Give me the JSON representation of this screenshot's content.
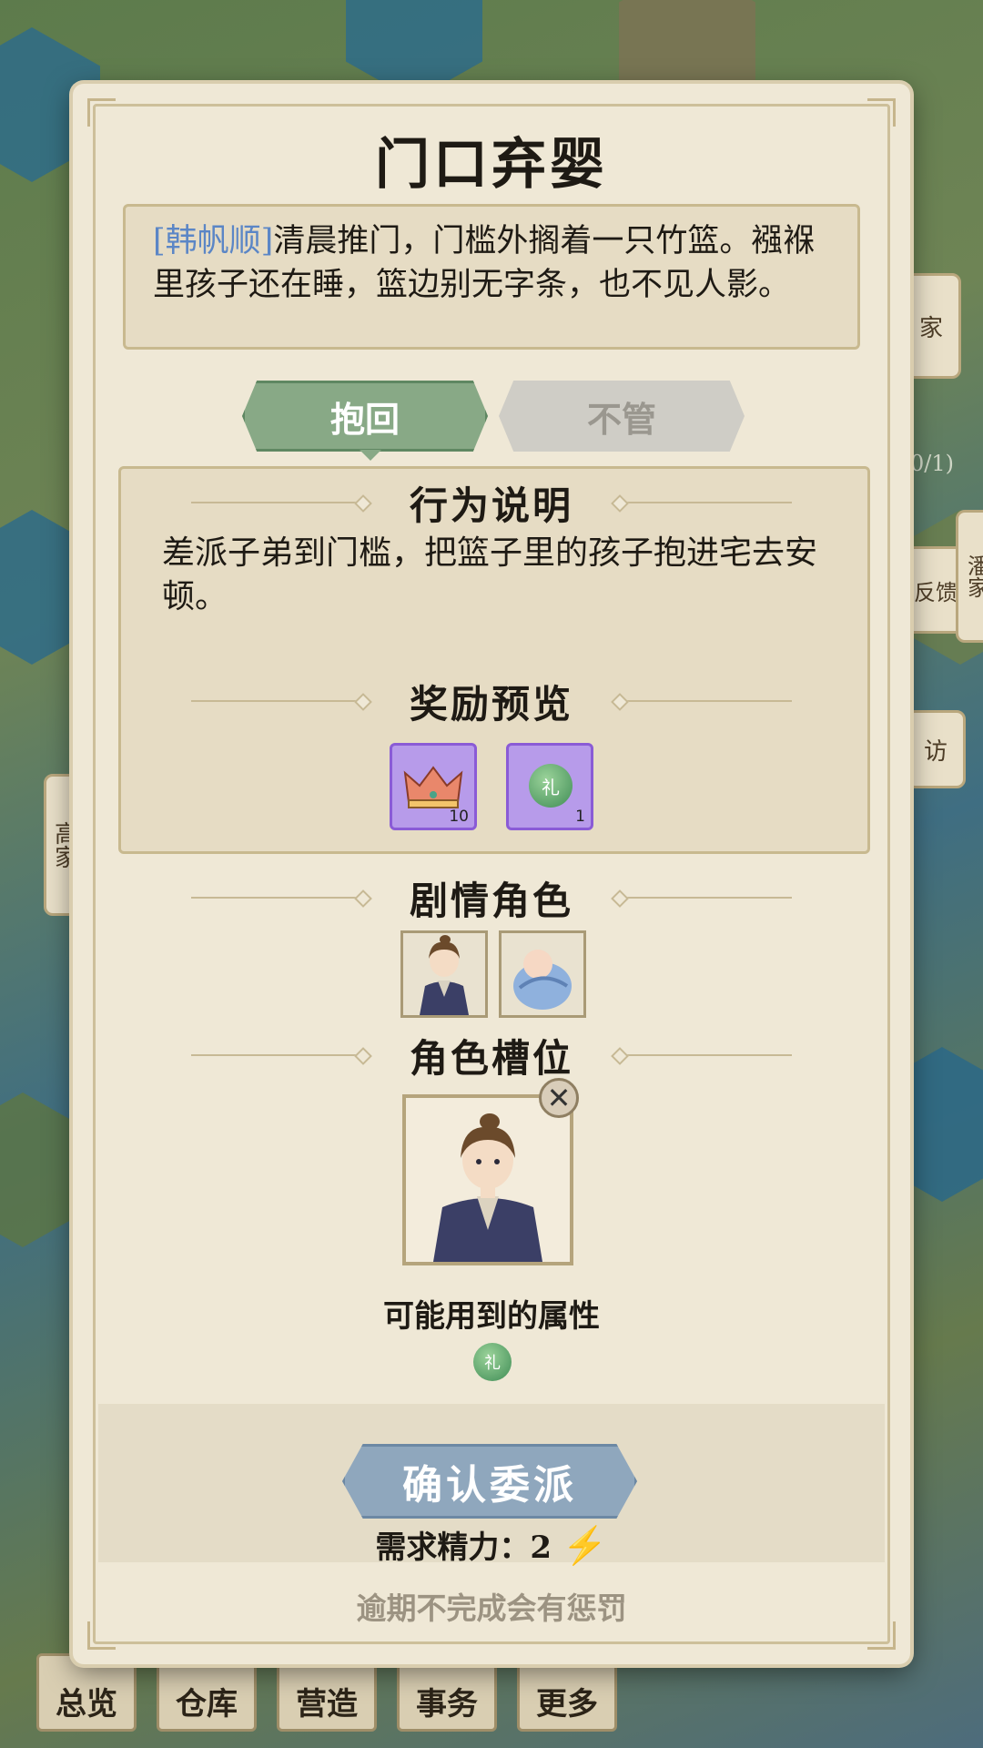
{
  "dialog": {
    "title": "门口弃婴",
    "story_name": "[韩帆顺]",
    "story_text": "清晨推门，门槛外搁着一只竹篮。襁褓里孩子还在睡，篮边别无字条，也不见人影。",
    "tabs": [
      {
        "label": "抱回",
        "active": true
      },
      {
        "label": "不管",
        "active": false
      }
    ],
    "behavior_heading": "行为说明",
    "behavior_text": "差派子弟到门槛，把篮子里的孩子抱进宅去安顿。",
    "reward_heading": "奖励预览",
    "rewards": [
      {
        "icon": "crown-icon",
        "count": "10"
      },
      {
        "icon": "etiquette-orb-icon",
        "glyph": "礼",
        "count": "1"
      }
    ],
    "characters_heading": "剧情角色",
    "characters": [
      "young-man-portrait",
      "baby-portrait"
    ],
    "slot_heading": "角色槽位",
    "attr_label": "可能用到的属性",
    "attr_glyph": "礼",
    "confirm_label": "确认委派",
    "energy_label": "需求精力：",
    "energy_value": "2",
    "energy_icon": "lightning-icon",
    "warning": "逾期不完成会有惩罚"
  },
  "background": {
    "side_labels": [
      "家",
      "反馈",
      "访",
      "潘家",
      "高家"
    ],
    "quest_counter": "0/1)",
    "bottom_tabs": [
      "总览",
      "仓库",
      "营造",
      "事务",
      "更多"
    ]
  },
  "colors": {
    "active_tab": "#88a986",
    "confirm_button": "#8fa7bd",
    "reward_bg": "#b79bea",
    "name_link": "#5b86c6"
  }
}
